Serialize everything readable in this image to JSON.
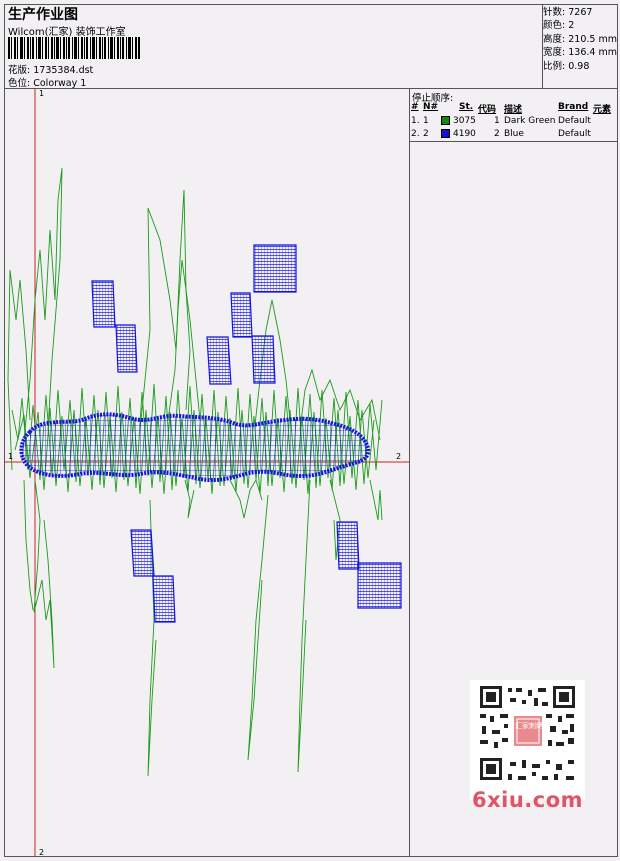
{
  "header": {
    "title": "生产作业图",
    "studio": "Wilcom(汇家) 装饰工作室",
    "design_label": "花版:",
    "design_value": "1735384.dst",
    "colorway_label": "色位:",
    "colorway_value": "Colorway 1"
  },
  "stats": [
    {
      "label": "针数:",
      "value": "7267"
    },
    {
      "label": "颜色:",
      "value": "2"
    },
    {
      "label": "高度:",
      "value": "210.5 mm"
    },
    {
      "label": "宽度:",
      "value": "136.4 mm"
    },
    {
      "label": "比例:",
      "value": "0.98"
    }
  ],
  "stop_sequence": {
    "heading": "停止顺序:",
    "columns": [
      "#",
      "N#",
      "St.",
      "代码",
      "描述",
      "Brand",
      "元素"
    ],
    "rows": [
      {
        "index": "1.",
        "n": "1",
        "swatch_color": "#0c8a0c",
        "st": "3075",
        "code": "1",
        "desc": "Dark Green",
        "brand": "Default"
      },
      {
        "index": "2.",
        "n": "2",
        "swatch_color": "#1111dd",
        "st": "4190",
        "code": "2",
        "desc": "Blue",
        "brand": "Default"
      }
    ]
  },
  "axis_labels": {
    "v_top": "1",
    "v_bottom": "2",
    "h_left": "1",
    "h_right": "2"
  },
  "colors": {
    "thread_green": "#1a9a1a",
    "thread_blue": "#1414e0",
    "axis_red": "#cc2222"
  },
  "watermark": "6xiu.com",
  "qr_badge": "汇家刺绣"
}
